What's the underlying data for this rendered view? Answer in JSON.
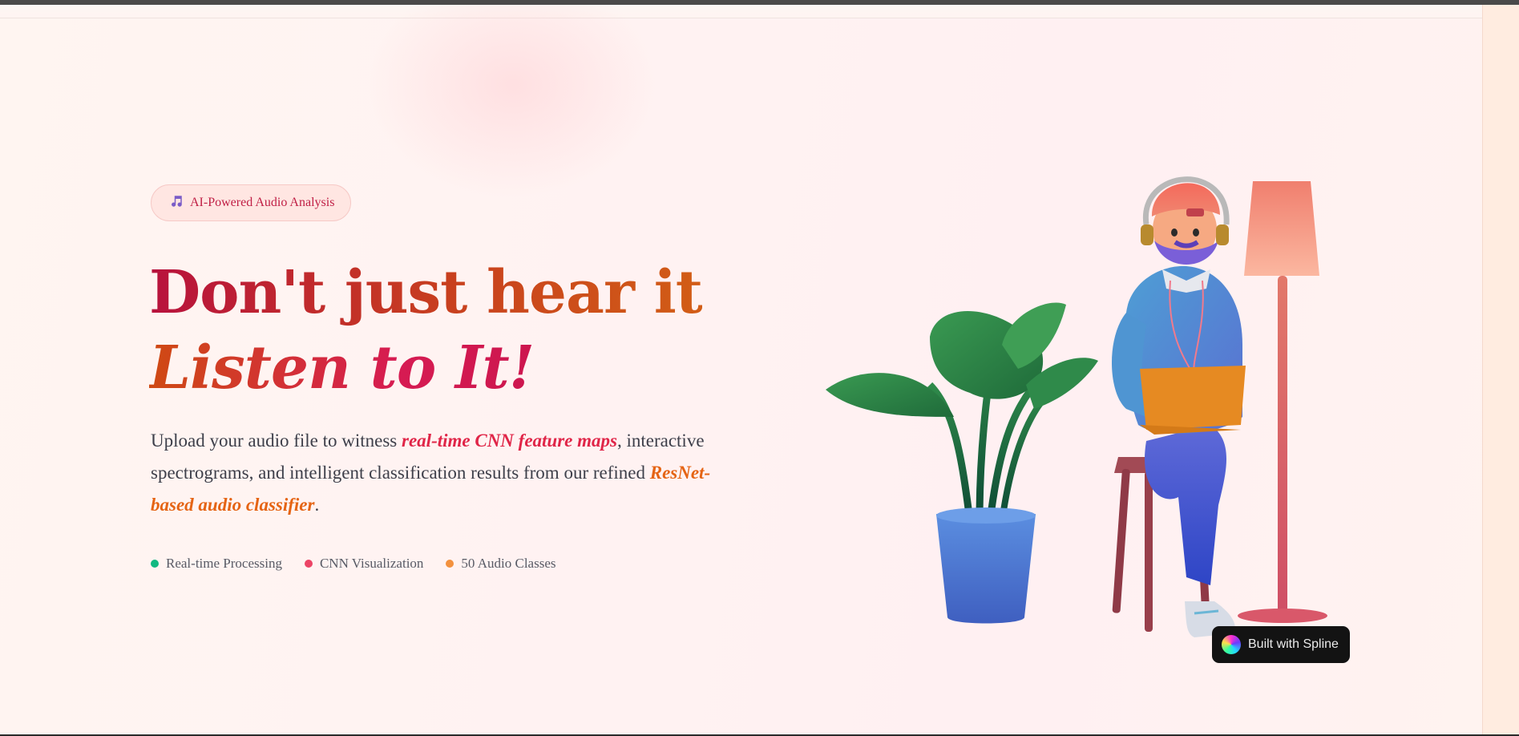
{
  "hero": {
    "badge_label": "AI-Powered Audio Analysis",
    "badge_icon": "music-note-icon",
    "headline_line1": "Don't just hear it",
    "headline_line2": "Listen to It!",
    "description": {
      "part1": "Upload your audio file to witness ",
      "highlight1": "real-time CNN feature maps",
      "part2": ", interactive spectrograms, and intelligent classification results from our refined ",
      "highlight2": "ResNet-based audio classifier",
      "part3": "."
    },
    "features": [
      {
        "label": "Real-time Processing",
        "dot_color": "#10b981"
      },
      {
        "label": "CNN Visualization",
        "dot_color": "#ec4466"
      },
      {
        "label": "50 Audio Classes",
        "dot_color": "#f3913e"
      }
    ]
  },
  "illustration": {
    "description_icon": "person-with-laptop-illustration"
  },
  "spline_badge": {
    "label": "Built with Spline"
  },
  "colors": {
    "accent_red": "#c01f45",
    "accent_orange": "#e56414",
    "background": "#fff2f1"
  }
}
